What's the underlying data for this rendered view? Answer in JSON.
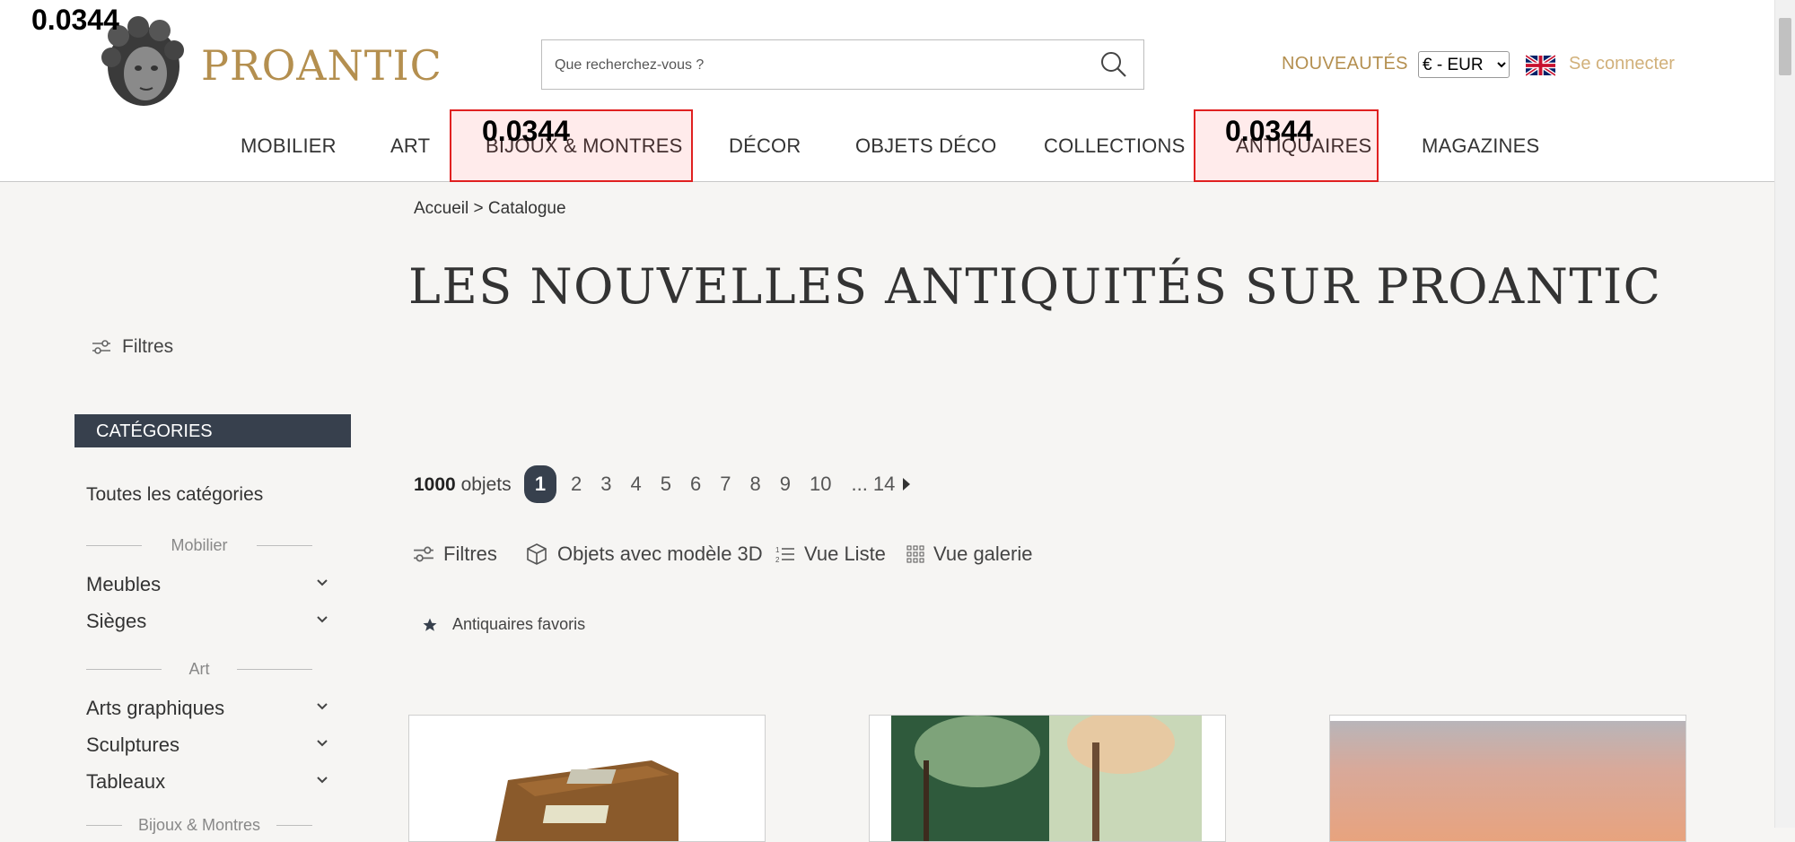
{
  "overlay_score": "0.0344",
  "header": {
    "logo_text": "PROANTIC",
    "search_placeholder": "Que recherchez-vous ?",
    "nouveautes": "NOUVEAUTÉS",
    "currency_selected": "€ - EUR",
    "login": "Se connecter"
  },
  "nav": {
    "mobilier": "MOBILIER",
    "art": "ART",
    "bijoux": "BIJOUX & MONTRES",
    "decor": "DÉCOR",
    "objets": "OBJETS DÉCO",
    "collections": "COLLECTIONS",
    "antiquaires": "ANTIQUAIRES",
    "magazines": "MAGAZINES"
  },
  "breadcrumb": "Accueil > Catalogue",
  "page_title": "LES NOUVELLES ANTIQUITÉS SUR PROANTIC",
  "sidebar": {
    "filters_label": "Filtres",
    "categories_header": "CATÉGORIES",
    "all_categories": "Toutes les catégories",
    "group_mobilier": "Mobilier",
    "meubles": "Meubles",
    "sieges": "Sièges",
    "group_art": "Art",
    "arts_graphiques": "Arts graphiques",
    "sculptures": "Sculptures",
    "tableaux": "Tableaux",
    "group_bijoux": "Bijoux & Montres"
  },
  "results": {
    "count_number": "1000",
    "count_label": "objets",
    "page_active": "1",
    "page_2": "2",
    "page_3": "3",
    "page_4": "4",
    "page_5": "5",
    "page_6": "6",
    "page_7": "7",
    "page_8": "8",
    "page_9": "9",
    "page_10": "10",
    "page_last": "... 14"
  },
  "toolbar": {
    "filters": "Filtres",
    "objects_3d": "Objets avec modèle 3D",
    "list_view": "Vue Liste",
    "gallery_view": "Vue galerie"
  },
  "favorites_label": "Antiquaires favoris",
  "colors": {
    "gold": "#b48f4f",
    "dark_slate": "#37404d",
    "background": "#f6f5f3"
  }
}
